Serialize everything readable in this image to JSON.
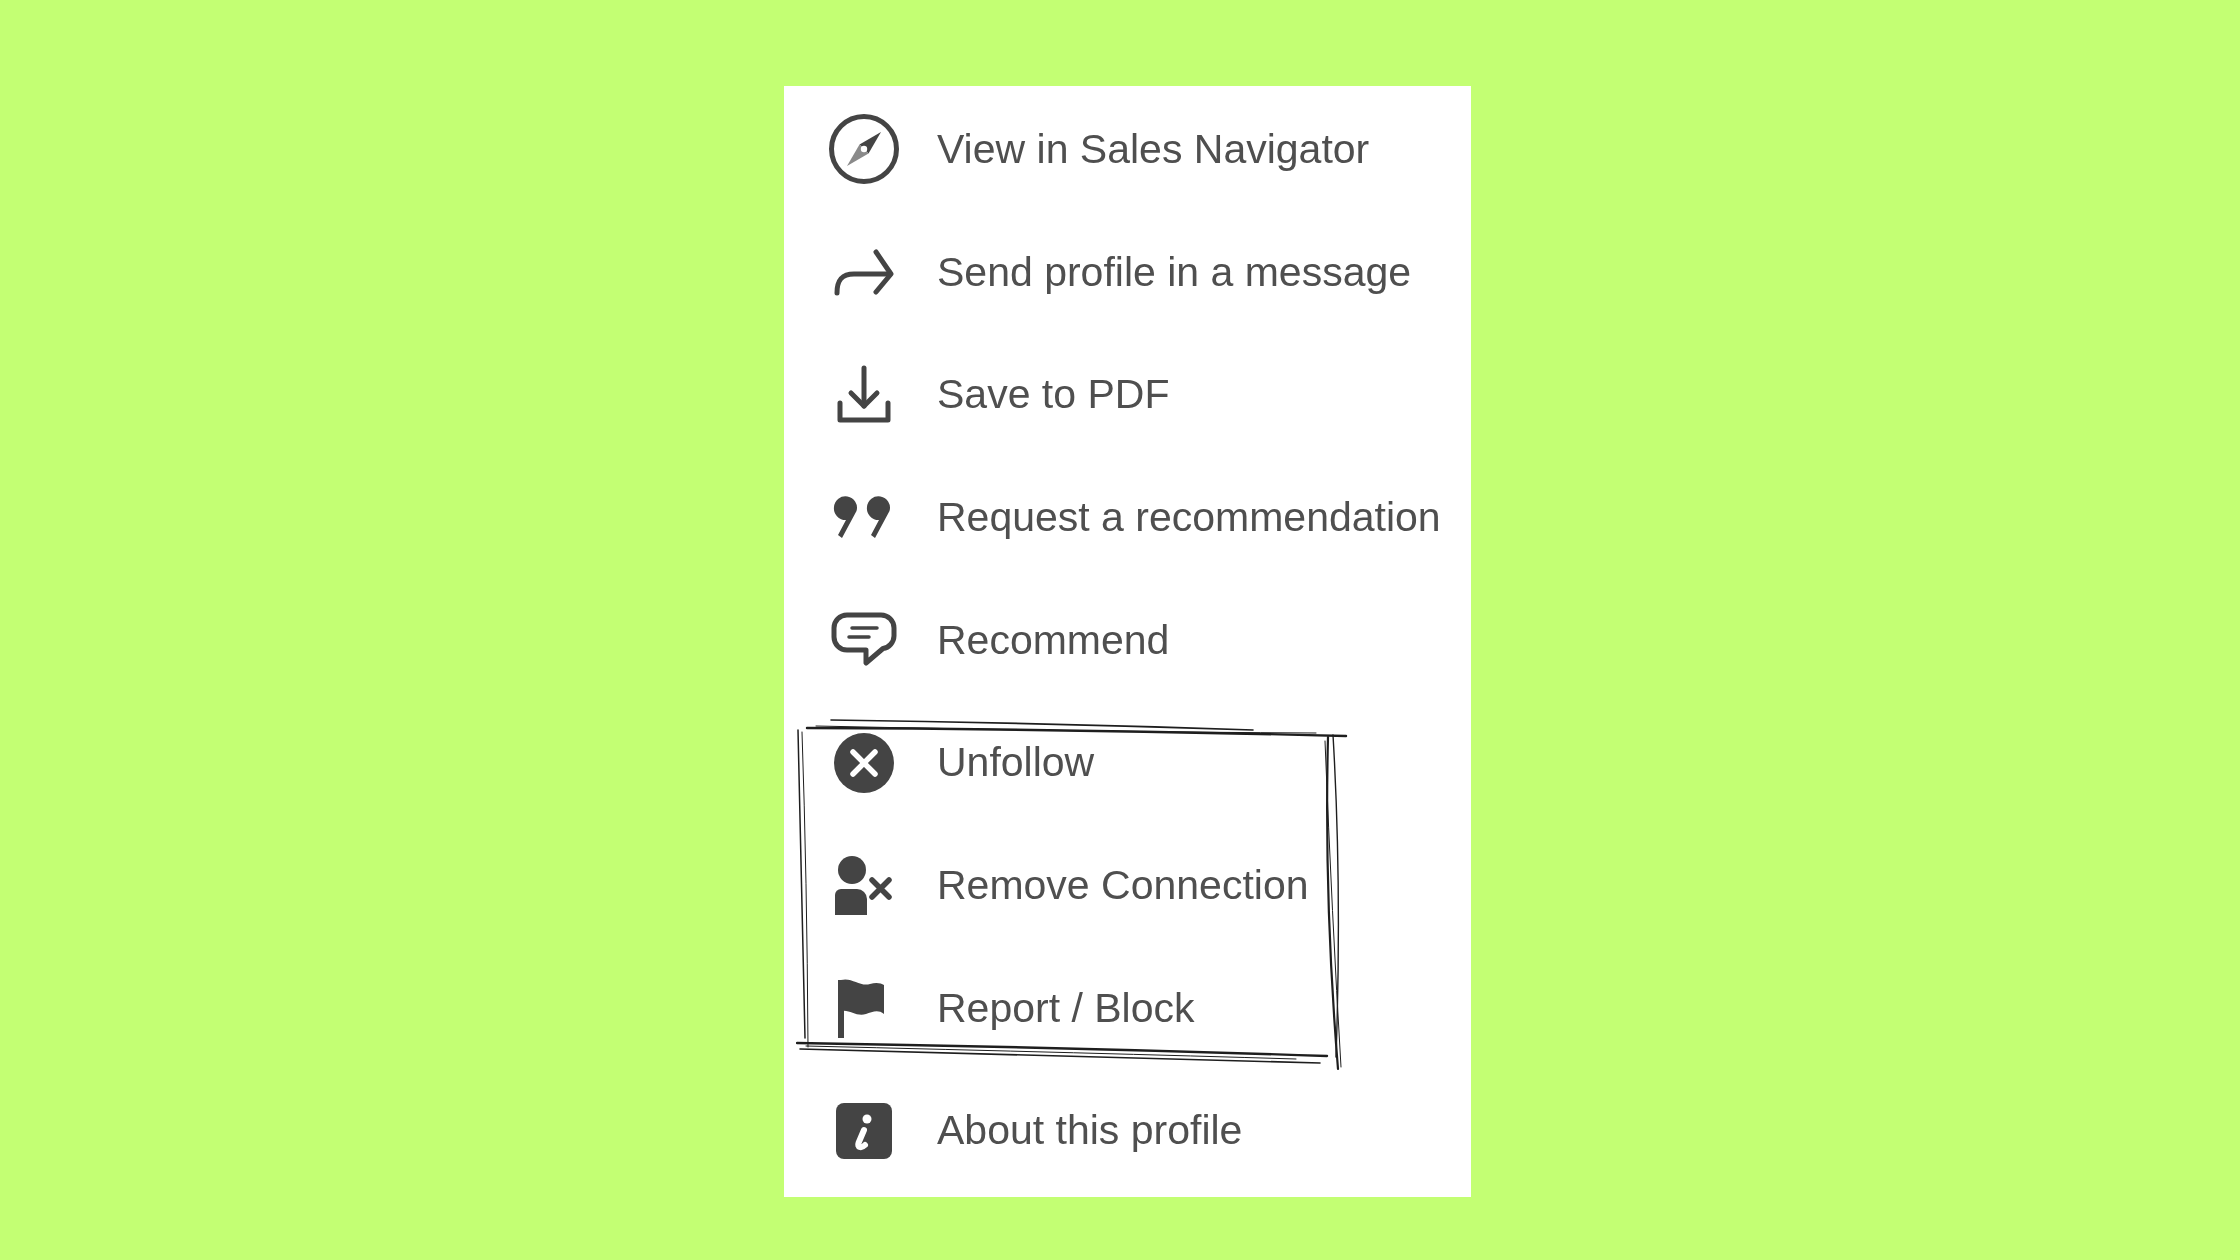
{
  "menu": {
    "groups": [
      {
        "highlighted": false,
        "items": [
          {
            "label": "View in Sales Navigator"
          },
          {
            "label": "Send profile in a message"
          },
          {
            "label": "Save to PDF"
          },
          {
            "label": "Request a recommendation"
          },
          {
            "label": "Recommend"
          }
        ]
      },
      {
        "highlighted": true,
        "items": [
          {
            "label": "Unfollow"
          },
          {
            "label": "Remove Connection"
          },
          {
            "label": "Report / Block"
          }
        ]
      },
      {
        "highlighted": false,
        "items": [
          {
            "label": "About this profile"
          }
        ]
      }
    ]
  }
}
